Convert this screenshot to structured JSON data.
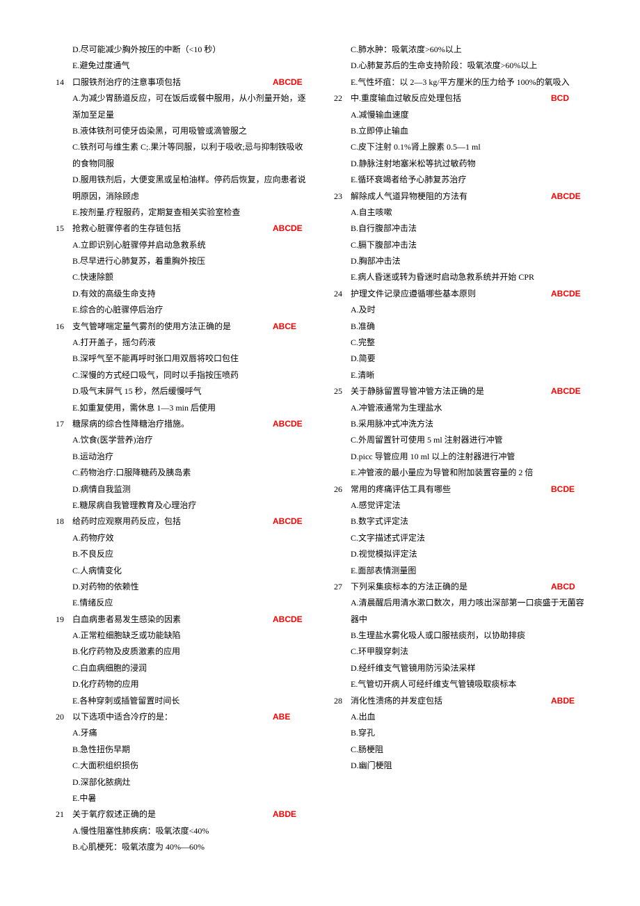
{
  "pre_options": [
    "D.尽可能减少胸外按压的中断（<10 秒）",
    "E.避免过度通气"
  ],
  "questions": [
    {
      "num": "14",
      "q": "口服铁剂治疗的注意事项包括",
      "ans": "ABCDE",
      "opts": [
        "A.为减少胃肠道反应，可在饭后或餐中服用，从小剂量开始，逐渐加至足量",
        "B.液体铁剂可使牙齿染黑，可用吸管或滴管服之",
        "C.铁剂可与维生素 C;.果汁等同服，以利于吸收;忌与抑制铁吸收的食物同服",
        "D.服用铁剂后，大便变黑或呈柏油样。停药后恢复，应向患者说明原因，消除顾虑",
        "E.按剂量.疗程服药，定期复查相关实验室检查"
      ]
    },
    {
      "num": "15",
      "q": "抢救心脏骤停者的生存链包括",
      "ans": "ABCDE",
      "opts": [
        "A.立即识别心脏骤停并启动急救系统",
        "B.尽早进行心肺复苏，着重胸外按压",
        "C.快速除颤",
        "D.有效的高级生命支持",
        "E.综合的心脏骤停后治疗"
      ]
    },
    {
      "num": "16",
      "q": "支气管哮喘定量气雾剂的使用方法正确的是",
      "ans": "ABCE",
      "opts": [
        "A.打开盖子，摇匀药液",
        "B.深呼气至不能再呼时张口用双唇将咬口包住",
        "C.深慢的方式经口吸气，同时以手指按压喷药",
        "D.吸气末屏气 15 秒，然后缓慢呼气",
        "E.如重复使用，需休息 1—3 min 后使用"
      ]
    },
    {
      "num": "17",
      "q": "糖尿病的综合性降糖治疗措施。",
      "ans": "ABCDE",
      "opts": [
        "A.饮食(医学营养)治疗",
        "B.运动治疗",
        "C.药物治疗:口服降糖药及胰岛素",
        "D.病情自我监测",
        "E.糖尿病自我管理教育及心理治疗"
      ]
    },
    {
      "num": "18",
      "q": "给药时应观察用药反应，包括",
      "ans": "ABCDE",
      "opts": [
        "A.药物疗效",
        "B.不良反应",
        "C.人病情变化",
        "D.对药物的依赖性",
        "E.情绪反应"
      ]
    },
    {
      "num": "19",
      "q": "白血病患者易发生感染的因素",
      "ans": "ABCDE",
      "opts": [
        "A.正常粒细胞缺乏或功能缺陷",
        "B.化疗药物及皮质激素的应用",
        "C.白血病细胞的浸润",
        "D.化疗药物的应用",
        "E.各种穿刺或插管留置时间长"
      ]
    },
    {
      "num": "20",
      "q": "以下选项中适合冷疗的是：",
      "ans": "ABE",
      "opts": [
        "A.牙痛",
        "B.急性扭伤早期",
        "C.大面积组织损伤",
        "D.深部化脓病灶",
        "E.中暑"
      ]
    },
    {
      "num": "21",
      "q": "关于氧疗叙述正确的是",
      "ans": "ABDE",
      "opts": [
        "A.慢性阻塞性肺疾病：吸氧浓度<40%",
        "B.心肌梗死：吸氧浓度为 40%—60%",
        "C.肺水肿：吸氧浓度>60%以上",
        "D.心肺复苏后的生命支持阶段：吸氧浓度>60%以上",
        "E.气性坏疽：以 2—3 kg/平方厘米的压力给予 100%的氧吸入"
      ]
    },
    {
      "num": "22",
      "q": "中.重度输血过敏反应处理包括",
      "ans": "BCD",
      "opts": [
        "A.减慢输血速度",
        "B.立即停止输血",
        "C.皮下注射 0.1%肾上腺素 0.5—1 ml",
        "D.静脉注射地塞米松等抗过敏药物",
        "E.循环衰竭者给予心肺复苏治疗"
      ]
    },
    {
      "num": "23",
      "q": "解除成人气道异物梗阻的方法有",
      "ans": "ABCDE",
      "opts": [
        "A.自主咳嗽",
        "B.自行腹部冲击法",
        "C.膈下腹部冲击法",
        "D.胸部冲击法",
        "E.病人昏迷或转为昏迷时启动急救系统并开始 CPR"
      ]
    },
    {
      "num": "24",
      "q": "护理文件记录应遵循哪些基本原则",
      "ans": "ABCDE",
      "opts": [
        "A.及时",
        "B.准确",
        "C.完整",
        "D.简要",
        "E.清晰"
      ]
    },
    {
      "num": "25",
      "q": "关于静脉留置导管冲管方法正确的是",
      "ans": "ABCDE",
      "opts": [
        "A.冲管液通常为生理盐水",
        "B.采用脉冲式冲洗方法",
        "C.外周留置针可使用 5 ml 注射器进行冲管",
        "D.picc 导管应用 10 ml 以上的注射器进行冲管",
        "E.冲管液的最小量应为导管和附加装置容量的 2 倍"
      ]
    },
    {
      "num": "26",
      "q": "常用的疼痛评估工具有哪些",
      "ans": "BCDE",
      "opts": [
        "A.感觉评定法",
        "B.数字式评定法",
        "C.文字描述式评定法",
        "D.视觉模拟评定法",
        "E.面部表情测量图"
      ]
    },
    {
      "num": "27",
      "q": "下列采集痰标本的方法正确的是",
      "ans": "ABCD",
      "opts": [
        "A.清晨醒后用清水漱口数次，用力咳出深部第一口痰盛于无菌容器中",
        "B.生理盐水雾化吸人或口服祛痰剂，以协助排痰",
        "C.环甲膜穿刺法",
        "D.经纤维支气管镜用防污染法采样",
        "E.气管切开病人可经纤维支气管镜吸取痰标本"
      ]
    },
    {
      "num": "28",
      "q": "消化性溃疡的并发症包括",
      "ans": "ABDE",
      "opts": [
        "A.出血",
        "B.穿孔",
        "C.肠梗阻",
        "D.幽门梗阻"
      ]
    }
  ]
}
